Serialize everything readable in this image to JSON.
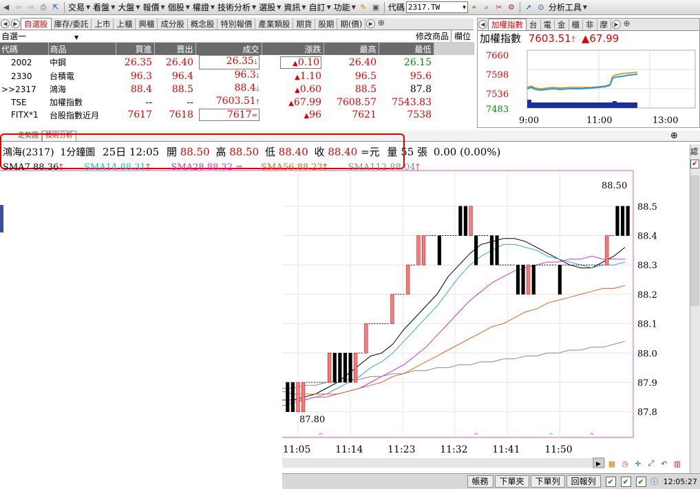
{
  "menu": {
    "items": [
      "交易",
      "看盤",
      "大盤",
      "報價",
      "個股",
      "權證",
      "技術分析",
      "選股",
      "資訊",
      "自訂",
      "功能"
    ],
    "code_label": "代碼",
    "code_value": "2317.TW",
    "analysis_tools": "分析工具"
  },
  "watchlist": {
    "tabs": [
      "自選股",
      "庫存/委託",
      "上市",
      "上櫃",
      "興櫃",
      "成分股",
      "概念股",
      "特別報價",
      "產業類股",
      "期貨",
      "股期",
      "期(價)"
    ],
    "list_name": "自選一",
    "edit_label": "修改商品",
    "column_label": "欄位",
    "headers": [
      "代碼",
      "商品",
      "買進",
      "賣出",
      "成交",
      "漲跌",
      "最高",
      "最低"
    ],
    "rows": [
      {
        "code": "2002",
        "name": "中鋼",
        "bid": "26.35",
        "ask": "26.40",
        "last": "26.35",
        "chg": "0.10",
        "high": "26.40",
        "low": "26.15"
      },
      {
        "code": "2330",
        "name": "台積電",
        "bid": "96.3",
        "ask": "96.4",
        "last": "96.3",
        "chg": "1.10",
        "high": "96.5",
        "low": "95.6"
      },
      {
        "code": ">>2317",
        "name": "鴻海",
        "bid": "88.4",
        "ask": "88.5",
        "last": "88.4",
        "chg": "0.60",
        "high": "88.5",
        "low": "87.8"
      },
      {
        "code": "TSE",
        "name": "加權指數",
        "bid": "--",
        "ask": "--",
        "last": "7603.51",
        "chg": "67.99",
        "high": "7608.57",
        "low": "7543.83"
      },
      {
        "code": "FITX*1",
        "name": "台股指數近月",
        "bid": "7617",
        "ask": "7618",
        "last": "7617",
        "chg": "96",
        "high": "7621",
        "low": "7538"
      }
    ]
  },
  "index_panel": {
    "tabs": [
      "加權指數",
      "台",
      "電",
      "金",
      "櫃",
      "非",
      "摩"
    ],
    "title": "加權指數",
    "value": "7603.51",
    "change": "▲67.99",
    "y_ticks": [
      "7660",
      "7598",
      "7536",
      "7483"
    ],
    "x_ticks": [
      "9:00",
      "11:00",
      "13:00"
    ]
  },
  "main": {
    "tabs": [
      "走勢圖",
      "技術分析"
    ],
    "header": {
      "stock": "鴻海(2317)",
      "period": "1分鐘圖",
      "date": "25日",
      "time": "12:05",
      "open_label": "開",
      "open": "88.50",
      "high_label": "高",
      "high": "88.50",
      "low_label": "低",
      "low": "88.40",
      "close_label": "收",
      "close": "88.40",
      "eq": "=元",
      "vol_label": "量",
      "vol": "55",
      "unit": "張",
      "chg": "0.00 (0.00%)"
    },
    "ma_legend": [
      {
        "label": "SMA7",
        "value": "88.36",
        "color": "#000000"
      },
      {
        "label": "SMA14",
        "value": "88.31",
        "color": "#33aadd"
      },
      {
        "label": "SMA28",
        "value": "88.32",
        "color": "#cc33cc"
      },
      {
        "label": "SMA56",
        "value": "88.23",
        "color": "#dd6622"
      },
      {
        "label": "SMA112",
        "value": "88.04",
        "color": "#888888"
      }
    ],
    "high_mark": "88.50",
    "low_mark": "87.80"
  },
  "chart_data": {
    "type": "candlestick",
    "y_ticks": [
      "88.5",
      "88.4",
      "88.3",
      "88.2",
      "88.1",
      "88.0",
      "87.9",
      "87.8"
    ],
    "ylim": [
      87.75,
      88.57
    ],
    "x_ticks": [
      "11:05",
      "11:14",
      "11:23",
      "11:32",
      "11:41",
      "11:50"
    ],
    "candles": [
      {
        "o": 87.9,
        "c": 87.8,
        "h": 87.9,
        "l": 87.8
      },
      {
        "o": 87.9,
        "c": 87.8,
        "h": 87.9,
        "l": 87.8
      },
      {
        "o": 87.8,
        "c": 87.9,
        "h": 87.9,
        "l": 87.8
      },
      {
        "o": 87.8,
        "c": 87.9,
        "h": 87.9,
        "l": 87.8
      },
      {
        "o": 87.9,
        "c": 87.9,
        "h": 87.9,
        "l": 87.9
      },
      {
        "o": 87.9,
        "c": 87.9,
        "h": 87.9,
        "l": 87.9
      },
      {
        "o": 87.9,
        "c": 87.9,
        "h": 87.9,
        "l": 87.9
      },
      {
        "o": 87.9,
        "c": 87.9,
        "h": 87.9,
        "l": 87.9
      },
      {
        "o": 87.9,
        "c": 88.0,
        "h": 88.0,
        "l": 87.9
      },
      {
        "o": 88.0,
        "c": 87.9,
        "h": 88.0,
        "l": 87.9
      },
      {
        "o": 88.0,
        "c": 87.9,
        "h": 88.0,
        "l": 87.9
      },
      {
        "o": 88.0,
        "c": 87.9,
        "h": 88.0,
        "l": 87.9
      },
      {
        "o": 88.0,
        "c": 87.9,
        "h": 88.0,
        "l": 87.9
      },
      {
        "o": 87.9,
        "c": 88.0,
        "h": 88.0,
        "l": 87.9
      },
      {
        "o": 88.0,
        "c": 88.0,
        "h": 88.0,
        "l": 88.0
      },
      {
        "o": 88.0,
        "c": 88.1,
        "h": 88.1,
        "l": 88.0
      },
      {
        "o": 88.1,
        "c": 88.1,
        "h": 88.1,
        "l": 88.1
      },
      {
        "o": 88.1,
        "c": 88.1,
        "h": 88.1,
        "l": 88.1
      },
      {
        "o": 88.1,
        "c": 88.1,
        "h": 88.1,
        "l": 88.1
      },
      {
        "o": 88.1,
        "c": 88.1,
        "h": 88.1,
        "l": 88.1
      },
      {
        "o": 88.1,
        "c": 88.2,
        "h": 88.2,
        "l": 88.1
      },
      {
        "o": 88.2,
        "c": 88.2,
        "h": 88.2,
        "l": 88.2
      },
      {
        "o": 88.2,
        "c": 88.2,
        "h": 88.2,
        "l": 88.2
      },
      {
        "o": 88.2,
        "c": 88.3,
        "h": 88.3,
        "l": 88.2
      },
      {
        "o": 88.3,
        "c": 88.3,
        "h": 88.3,
        "l": 88.3
      },
      {
        "o": 88.3,
        "c": 88.4,
        "h": 88.4,
        "l": 88.3
      },
      {
        "o": 88.3,
        "c": 88.4,
        "h": 88.4,
        "l": 88.3
      },
      {
        "o": 88.4,
        "c": 88.4,
        "h": 88.4,
        "l": 88.4
      },
      {
        "o": 88.4,
        "c": 88.4,
        "h": 88.4,
        "l": 88.4
      },
      {
        "o": 88.4,
        "c": 88.3,
        "h": 88.4,
        "l": 88.3
      },
      {
        "o": 88.4,
        "c": 88.4,
        "h": 88.4,
        "l": 88.4
      },
      {
        "o": 88.4,
        "c": 88.4,
        "h": 88.4,
        "l": 88.4
      },
      {
        "o": 88.4,
        "c": 88.4,
        "h": 88.4,
        "l": 88.4
      },
      {
        "o": 88.5,
        "c": 88.4,
        "h": 88.5,
        "l": 88.4
      },
      {
        "o": 88.5,
        "c": 88.4,
        "h": 88.5,
        "l": 88.4
      },
      {
        "o": 88.4,
        "c": 88.5,
        "h": 88.5,
        "l": 88.4
      },
      {
        "o": 88.4,
        "c": 88.3,
        "h": 88.4,
        "l": 88.3
      },
      {
        "o": 88.4,
        "c": 88.4,
        "h": 88.4,
        "l": 88.4
      },
      {
        "o": 88.4,
        "c": 88.4,
        "h": 88.4,
        "l": 88.4
      },
      {
        "o": 88.4,
        "c": 88.3,
        "h": 88.4,
        "l": 88.3
      },
      {
        "o": 88.4,
        "c": 88.3,
        "h": 88.4,
        "l": 88.3
      },
      {
        "o": 88.3,
        "c": 88.3,
        "h": 88.3,
        "l": 88.3
      },
      {
        "o": 88.3,
        "c": 88.3,
        "h": 88.3,
        "l": 88.3
      },
      {
        "o": 88.3,
        "c": 88.3,
        "h": 88.3,
        "l": 88.3
      },
      {
        "o": 88.3,
        "c": 88.2,
        "h": 88.3,
        "l": 88.2
      },
      {
        "o": 88.3,
        "c": 88.2,
        "h": 88.3,
        "l": 88.2
      },
      {
        "o": 88.2,
        "c": 88.3,
        "h": 88.3,
        "l": 88.2
      },
      {
        "o": 88.3,
        "c": 88.2,
        "h": 88.3,
        "l": 88.2
      },
      {
        "o": 88.3,
        "c": 88.3,
        "h": 88.3,
        "l": 88.3
      },
      {
        "o": 88.3,
        "c": 88.3,
        "h": 88.3,
        "l": 88.3
      },
      {
        "o": 88.3,
        "c": 88.3,
        "h": 88.3,
        "l": 88.3
      },
      {
        "o": 88.3,
        "c": 88.3,
        "h": 88.3,
        "l": 88.3
      },
      {
        "o": 88.3,
        "c": 88.2,
        "h": 88.3,
        "l": 88.2
      },
      {
        "o": 88.3,
        "c": 88.3,
        "h": 88.3,
        "l": 88.3
      },
      {
        "o": 88.3,
        "c": 88.3,
        "h": 88.3,
        "l": 88.3
      },
      {
        "o": 88.3,
        "c": 88.3,
        "h": 88.3,
        "l": 88.3
      },
      {
        "o": 88.3,
        "c": 88.3,
        "h": 88.3,
        "l": 88.3
      },
      {
        "o": 88.3,
        "c": 88.3,
        "h": 88.3,
        "l": 88.3
      },
      {
        "o": 88.3,
        "c": 88.3,
        "h": 88.3,
        "l": 88.3
      },
      {
        "o": 88.3,
        "c": 88.3,
        "h": 88.3,
        "l": 88.3
      },
      {
        "o": 88.3,
        "c": 88.3,
        "h": 88.3,
        "l": 88.3
      },
      {
        "o": 88.3,
        "c": 88.4,
        "h": 88.4,
        "l": 88.3
      },
      {
        "o": 88.4,
        "c": 88.4,
        "h": 88.4,
        "l": 88.4
      },
      {
        "o": 88.5,
        "c": 88.4,
        "h": 88.5,
        "l": 88.4
      },
      {
        "o": 88.5,
        "c": 88.4,
        "h": 88.5,
        "l": 88.4
      },
      {
        "o": 88.5,
        "c": 88.4,
        "h": 88.5,
        "l": 88.4
      }
    ],
    "series": [
      {
        "name": "SMA7",
        "values": [
          87.84,
          87.84,
          87.85,
          87.86,
          87.88,
          87.9,
          87.93,
          87.96,
          87.99,
          88.0,
          88.03,
          88.08,
          88.12,
          88.16,
          88.2,
          88.26,
          88.3,
          88.34,
          88.37,
          88.38,
          88.39,
          88.39,
          88.38,
          88.36,
          88.34,
          88.32,
          88.3,
          88.29,
          88.29,
          88.31,
          88.33,
          88.36
        ]
      },
      {
        "name": "SMA14",
        "values": [
          87.82,
          87.83,
          87.84,
          87.85,
          87.86,
          87.88,
          87.9,
          87.92,
          87.95,
          87.97,
          88.0,
          88.04,
          88.08,
          88.12,
          88.16,
          88.21,
          88.26,
          88.3,
          88.33,
          88.35,
          88.37,
          88.37,
          88.36,
          88.35,
          88.33,
          88.32,
          88.31,
          88.3,
          88.29,
          88.3,
          88.3,
          88.31
        ]
      },
      {
        "name": "SMA28",
        "values": [
          87.84,
          87.84,
          87.84,
          87.85,
          87.85,
          87.86,
          87.87,
          87.88,
          87.9,
          87.92,
          87.94,
          87.96,
          87.99,
          88.02,
          88.06,
          88.1,
          88.14,
          88.18,
          88.21,
          88.24,
          88.26,
          88.28,
          88.29,
          88.3,
          88.31,
          88.31,
          88.32,
          88.32,
          88.33,
          88.32,
          88.32,
          88.32
        ]
      },
      {
        "name": "SMA56",
        "values": [
          87.87,
          87.86,
          87.86,
          87.86,
          87.86,
          87.86,
          87.87,
          87.88,
          87.89,
          87.9,
          87.92,
          87.93,
          87.95,
          87.97,
          87.99,
          88.01,
          88.03,
          88.05,
          88.07,
          88.09,
          88.1,
          88.12,
          88.14,
          88.15,
          88.17,
          88.18,
          88.19,
          88.2,
          88.21,
          88.22,
          88.22,
          88.23
        ]
      },
      {
        "name": "SMA112",
        "values": [
          87.88,
          87.88,
          87.89,
          87.89,
          87.9,
          87.9,
          87.91,
          87.91,
          87.92,
          87.92,
          87.93,
          87.93,
          87.94,
          87.94,
          87.95,
          87.95,
          87.96,
          87.96,
          87.97,
          87.97,
          87.98,
          87.98,
          87.99,
          87.99,
          88.0,
          88.0,
          88.01,
          88.01,
          88.02,
          88.02,
          88.03,
          88.04
        ]
      }
    ]
  },
  "status": {
    "buttons": [
      "帳務",
      "下單夾",
      "下單列",
      "回報列"
    ],
    "time": "12:05:27"
  },
  "colors": {
    "up": "#e00000",
    "down": "#008800",
    "header_gray": "#6a6a6a",
    "highlight": "#e00000"
  }
}
